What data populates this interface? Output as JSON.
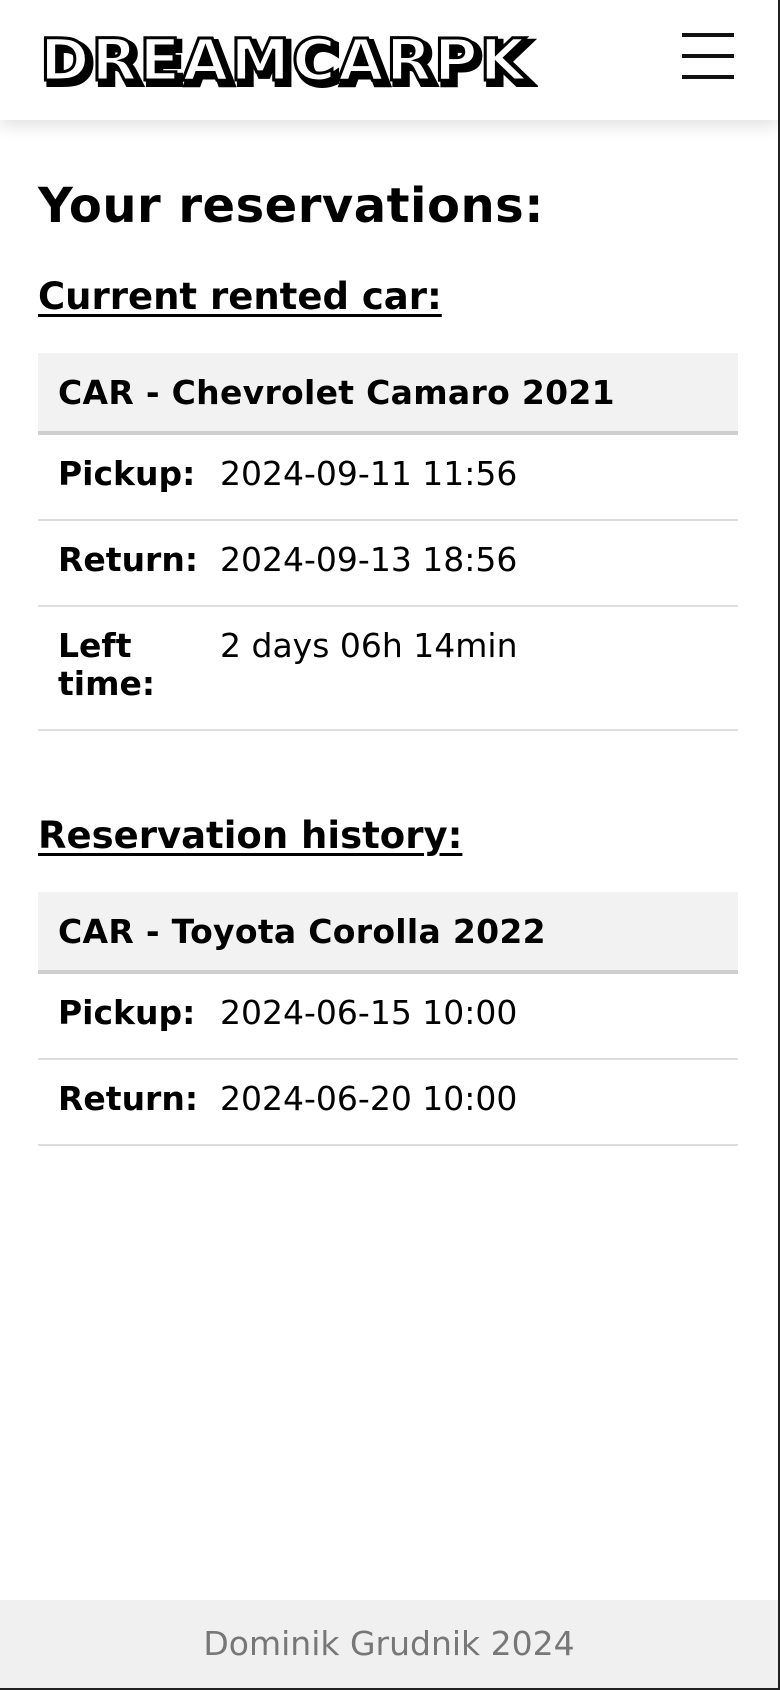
{
  "header": {
    "logo_text": "DREAMCARPK",
    "menu_icon": "hamburger-menu-icon"
  },
  "main": {
    "title": "Your reservations:",
    "current": {
      "heading": "Current rented car:",
      "car": "CAR - Chevrolet Camaro 2021",
      "rows": [
        {
          "label": "Pickup:",
          "value": "2024-09-11 11:56"
        },
        {
          "label": "Return:",
          "value": "2024-09-13 18:56"
        },
        {
          "label": "Left time:",
          "value": "2 days 06h 14min"
        }
      ]
    },
    "history": {
      "heading": "Reservation history:",
      "car": "CAR - Toyota Corolla 2022",
      "rows": [
        {
          "label": "Pickup:",
          "value": "2024-06-15 10:00"
        },
        {
          "label": "Return:",
          "value": "2024-06-20 10:00"
        }
      ]
    }
  },
  "footer": {
    "text": "Dominik Grudnik 2024"
  }
}
